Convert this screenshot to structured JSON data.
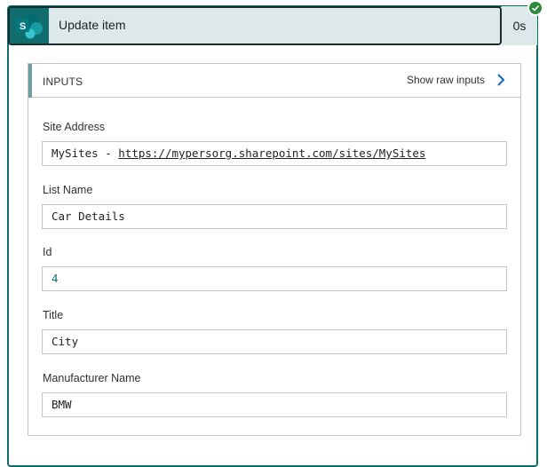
{
  "header": {
    "title": "Update item",
    "duration": "0s",
    "logo_letter": "S",
    "logo_icon": "sharepoint-icon",
    "status_icon": "checkmark-icon",
    "status_color": "#2d8a3a",
    "accent_color": "#0f6d6d"
  },
  "inputs": {
    "title": "INPUTS",
    "show_raw_label": "Show raw inputs",
    "fields": {
      "site_address": {
        "label": "Site Address",
        "prefix": "MySites - ",
        "url": "https://mypersorg.sharepoint.com/sites/MySites"
      },
      "list_name": {
        "label": "List Name",
        "value": "Car Details"
      },
      "id": {
        "label": "Id",
        "value": "4"
      },
      "title": {
        "label": "Title",
        "value": "City"
      },
      "manufacturer": {
        "label": "Manufacturer Name",
        "value": "BMW"
      }
    }
  }
}
